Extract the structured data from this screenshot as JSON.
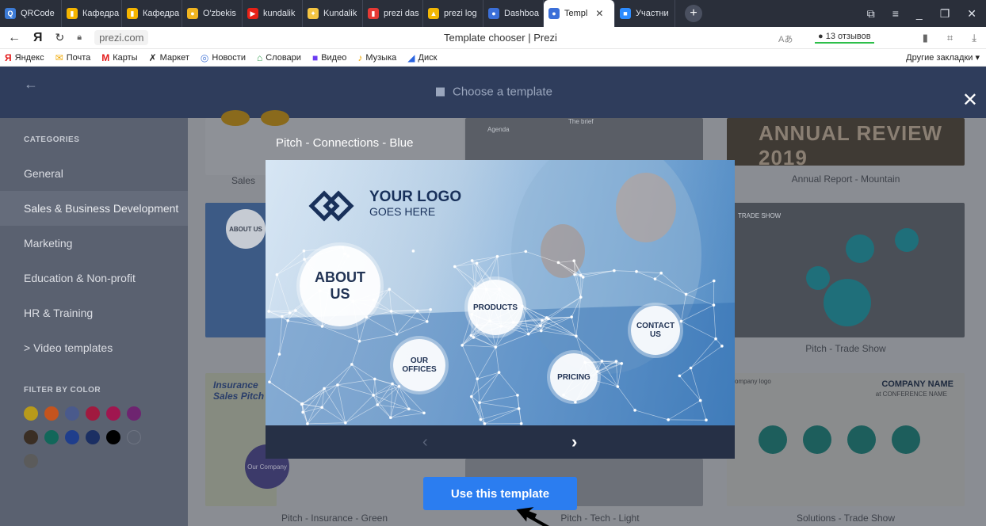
{
  "browser": {
    "tabs": [
      {
        "label": "QRCode",
        "color": "#3c7bd6",
        "glyph": "Q"
      },
      {
        "label": "Кафедра",
        "color": "#f4b400",
        "glyph": "▮"
      },
      {
        "label": "Кафедра",
        "color": "#f4b400",
        "glyph": "▮"
      },
      {
        "label": "O'zbekis",
        "color": "#f0b420",
        "glyph": "●"
      },
      {
        "label": "kundalik",
        "color": "#e62117",
        "glyph": "▶"
      },
      {
        "label": "Kundalik",
        "color": "#f5c542",
        "glyph": "✦"
      },
      {
        "label": "prezi das",
        "color": "#e53935",
        "glyph": "▮"
      },
      {
        "label": "prezi log",
        "color": "#f2b705",
        "glyph": "▲"
      },
      {
        "label": "Dashboa",
        "color": "#3b6fd8",
        "glyph": "●"
      },
      {
        "label": "Templ",
        "color": "#3b6fd8",
        "glyph": "●"
      },
      {
        "label": "Участни",
        "color": "#2d8cff",
        "glyph": "■"
      }
    ],
    "url": "prezi.com",
    "page_title": "Template chooser | Prezi",
    "reviews": "13 отзывов",
    "bookmarks": [
      {
        "label": "Яндекс",
        "glyph": "Я",
        "color": "#e31b1b"
      },
      {
        "label": "Почта",
        "glyph": "✉",
        "color": "#f0a800"
      },
      {
        "label": "Карты",
        "glyph": "M",
        "color": "#e31b1b"
      },
      {
        "label": "Маркет",
        "glyph": "✗",
        "color": "#222"
      },
      {
        "label": "Новости",
        "glyph": "◎",
        "color": "#4a7ad8"
      },
      {
        "label": "Словари",
        "glyph": "⌂",
        "color": "#2f9e4f"
      },
      {
        "label": "Видео",
        "glyph": "■",
        "color": "#6b3cf2"
      },
      {
        "label": "Музыка",
        "glyph": "♪",
        "color": "#f0a800"
      },
      {
        "label": "Диск",
        "glyph": "◢",
        "color": "#2a64e0"
      }
    ],
    "other_bookmarks": "Другие закладки ▾"
  },
  "app": {
    "header_title": "Choose a template",
    "sidebar": {
      "categories_heading": "CATEGORIES",
      "categories": [
        "General",
        "Sales & Business Development",
        "Marketing",
        "Education & Non-profit",
        "HR & Training",
        "> Video templates"
      ],
      "active_category": "Sales & Business Development",
      "filter_heading": "FILTER BY COLOR",
      "colors": [
        "#b89a1a",
        "#c4541e",
        "#4a5a8c",
        "#a01a3f",
        "#a0164f",
        "#6e2470",
        "#3a2e24",
        "#12675a",
        "#1f3e8c",
        "#1b2f63",
        "#000000",
        "#ffffff",
        "#5b5b5b"
      ]
    },
    "grid_captions": [
      "Sales",
      "Annual Report - Mountain",
      "Pitch - Trade Show",
      "Pitch - Insurance - Green",
      "Pitch - Tech - Light",
      "Solutions - Trade Show"
    ],
    "grid_card_texts": {
      "annual": "ANNUAL REVIEW 2019",
      "trade_show": "TRADE SHOW",
      "insurance": "Insurance Sales Pitch",
      "company_name": "COMPANY NAME",
      "conference": "at CONFERENCE NAME",
      "agenda": "Agenda",
      "brief": "The brief",
      "about_us_small": "ABOUT US",
      "our_company": "Our Company",
      "company_logo": "company logo"
    },
    "modal": {
      "title": "Pitch - Connections - Blue",
      "logo_line1": "YOUR LOGO",
      "logo_line2": "GOES HERE",
      "bubbles": {
        "about": "ABOUT US",
        "products": "PRODUCTS",
        "contact": "CONTACT US",
        "offices": "OUR OFFICES",
        "pricing": "PRICING"
      },
      "use_button": "Use this template"
    }
  }
}
